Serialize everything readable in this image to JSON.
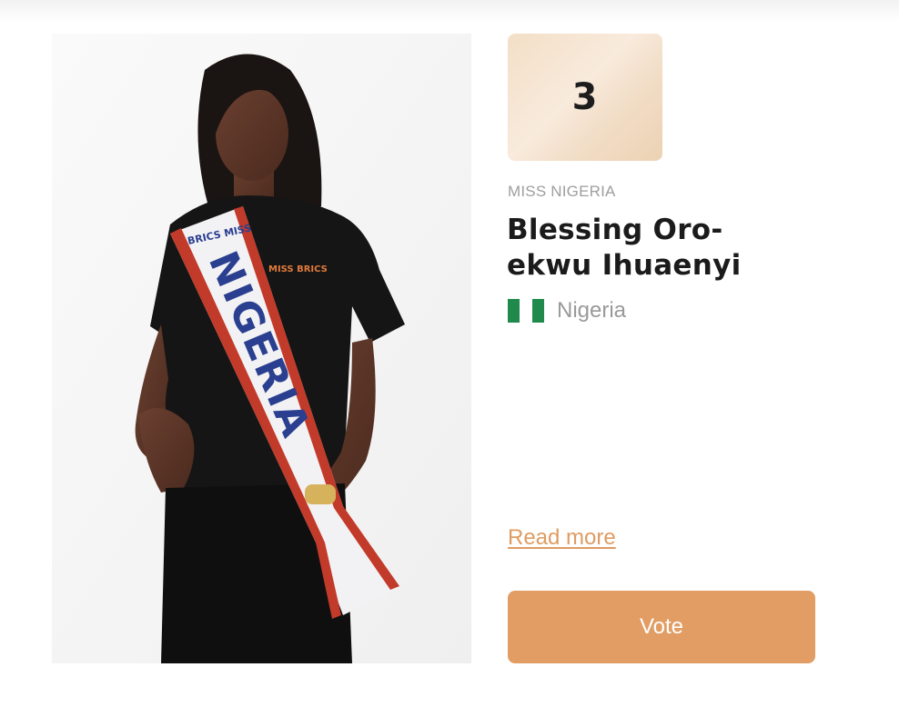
{
  "contestant": {
    "rank": "3",
    "title": "MISS NIGERIA",
    "name": "Blessing Oro-ekwu Ihuaenyi",
    "country": "Nigeria"
  },
  "photo": {
    "sash_text": "NIGERIA",
    "sash_brand": "BRICS MISS",
    "shirt_logo": "MISS BRICS"
  },
  "actions": {
    "read_more_label": "Read more",
    "vote_label": "Vote"
  },
  "colors": {
    "accent": "#e19d63",
    "flag_green": "#1f8a4c",
    "flag_white": "#ffffff"
  },
  "icons": {
    "flag": "nigeria-flag-icon"
  }
}
